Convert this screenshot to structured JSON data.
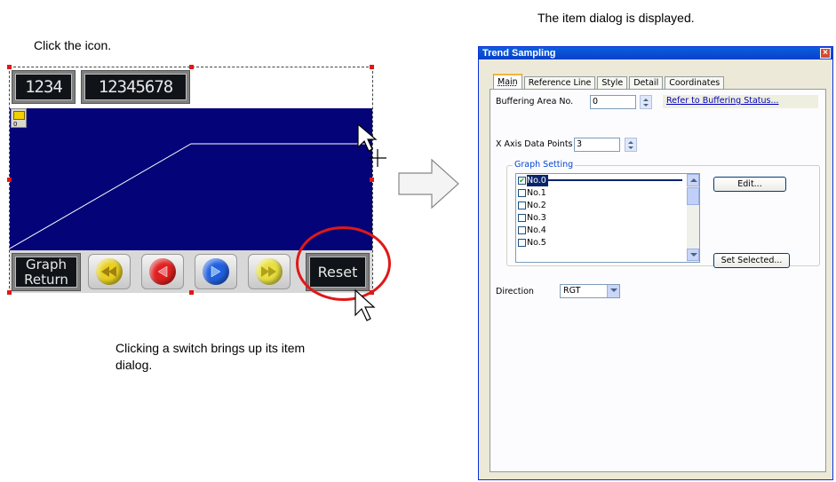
{
  "captions": {
    "click_icon": "Click the icon.",
    "dialog_displayed": "The item dialog is displayed.",
    "switch_note": "Clicking a switch brings up its item dialog."
  },
  "editor": {
    "num_display_1": "1234",
    "num_display_2": "12345678",
    "trend_icon_number": "0",
    "switches": {
      "graph_return": "Graph Return",
      "reset": "Reset"
    },
    "switch_icons": [
      "fast-rewind-icon",
      "rewind-icon",
      "forward-icon",
      "fast-forward-icon"
    ],
    "colors": {
      "graph_bg": "#040478",
      "highlight": "#e01818"
    }
  },
  "dialog": {
    "title": "Trend Sampling",
    "tabs": [
      "Main",
      "Reference Line",
      "Style",
      "Detail",
      "Coordinates"
    ],
    "active_tab": "Main",
    "buffering_area_label": "Buffering Area No.",
    "buffering_area_value": "0",
    "refer_link": "Refer to Buffering Status...",
    "x_axis_label": "X Axis Data Points",
    "x_axis_value": "3",
    "graph_setting_label": "Graph Setting",
    "graph_items": [
      {
        "label": "No.0",
        "checked": true,
        "selected": true
      },
      {
        "label": "No.1",
        "checked": false,
        "selected": false
      },
      {
        "label": "No.2",
        "checked": false,
        "selected": false
      },
      {
        "label": "No.3",
        "checked": false,
        "selected": false
      },
      {
        "label": "No.4",
        "checked": false,
        "selected": false
      },
      {
        "label": "No.5",
        "checked": false,
        "selected": false
      }
    ],
    "edit_button": "Edit...",
    "set_selected_button": "Set Selected...",
    "direction_label": "Direction",
    "direction_value": "RGT"
  }
}
